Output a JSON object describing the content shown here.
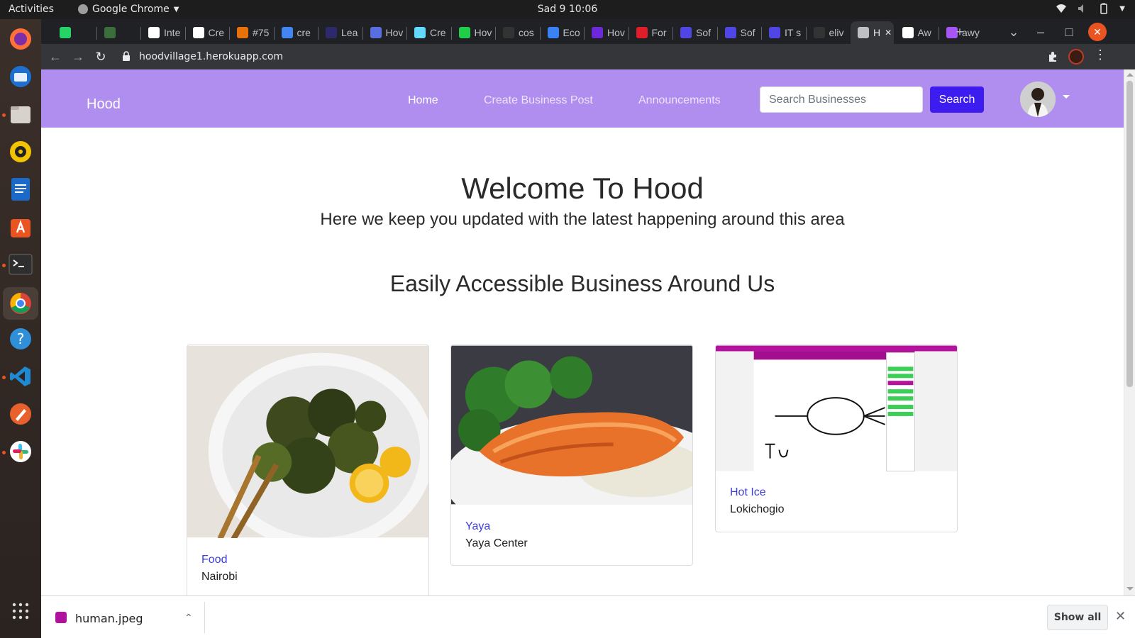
{
  "system": {
    "activities": "Activities",
    "app_name": "Google Chrome",
    "clock": "Sad 9  10:06"
  },
  "dock": {
    "apps": [
      "firefox-icon",
      "thunderbird-icon",
      "files-icon",
      "rhythmbox-icon",
      "writer-icon",
      "software-icon",
      "terminal-icon",
      "chrome-icon",
      "help-icon",
      "vscode-icon",
      "inkscape-icon",
      "slack-icon",
      "app-grid-icon"
    ]
  },
  "browser": {
    "tabs": [
      {
        "label": "",
        "color": "#25d366"
      },
      {
        "label": "",
        "color": "#3c6e3c"
      },
      {
        "label": "Inte",
        "color": "#ffffff"
      },
      {
        "label": "Cre",
        "color": "#ffffff"
      },
      {
        "label": "#75",
        "color": "#e8710a"
      },
      {
        "label": "cre",
        "color": "#4285f4"
      },
      {
        "label": "Lea",
        "color": "#2d2a6b"
      },
      {
        "label": "Hov",
        "color": "#5b6ee1"
      },
      {
        "label": "Cre",
        "color": "#61dafb"
      },
      {
        "label": "Hov",
        "color": "#1fcf4a"
      },
      {
        "label": "cos",
        "color": "#333333"
      },
      {
        "label": "Eco",
        "color": "#3b82f6"
      },
      {
        "label": "Hov",
        "color": "#6d28d9"
      },
      {
        "label": "For",
        "color": "#e11d2a"
      },
      {
        "label": "Sof",
        "color": "#4f46e5"
      },
      {
        "label": "Sof",
        "color": "#4f46e5"
      },
      {
        "label": "IT s",
        "color": "#4f46e5"
      },
      {
        "label": "eliv",
        "color": "#333333"
      },
      {
        "label": "H",
        "color": "#bdc1c6",
        "active": true
      },
      {
        "label": "Aw",
        "color": "#ffffff"
      },
      {
        "label": "awy",
        "color": "#a855f7"
      }
    ],
    "url": "hoodvillage1.herokuapp.com"
  },
  "navbar": {
    "brand": "Hood",
    "links": [
      "Home",
      "Create Business Post",
      "Announcements"
    ],
    "search_placeholder": "Search Businesses",
    "search_button": "Search",
    "accent_color": "#b08ef0",
    "button_color": "#3d1cf0"
  },
  "hero": {
    "title": "Welcome To Hood",
    "subtitle": "Here we keep you updated with the latest happening around this area"
  },
  "section": {
    "title": "Easily Accessible Business Around Us"
  },
  "businesses": [
    {
      "category": "Food",
      "location": "Nairobi",
      "image": "broccoli-lemon-plate"
    },
    {
      "category": "Yaya",
      "location": "Yaya Center",
      "image": "salmon-rice-plate"
    },
    {
      "category": "Hot Ice",
      "location": "Lokichogio",
      "image": "drawing-app-screenshot"
    }
  ],
  "downloads": {
    "file_name": "human.jpeg",
    "show_all": "Show all"
  }
}
